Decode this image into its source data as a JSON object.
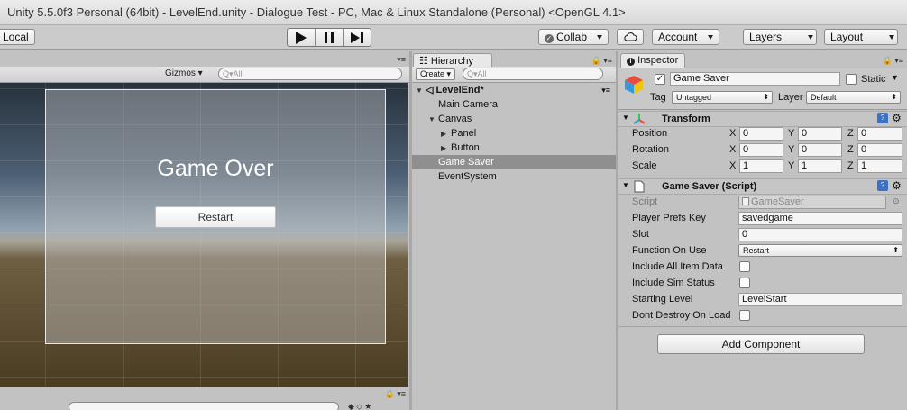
{
  "window": {
    "title": "Unity 5.5.0f3 Personal (64bit) - LevelEnd.unity - Dialogue Test - PC, Mac & Linux Standalone (Personal) <OpenGL 4.1>"
  },
  "toolbar": {
    "local_label": "Local",
    "collab_label": "Collab",
    "account_label": "Account",
    "layers_label": "Layers",
    "layout_label": "Layout"
  },
  "scene": {
    "gizmos_label": "Gizmos",
    "search_placeholder": "Q▾All",
    "game_over_text": "Game Over",
    "restart_label": "Restart"
  },
  "hierarchy": {
    "tab_label": "Hierarchy",
    "create_label": "Create",
    "search_placeholder": "Q▾All",
    "items": [
      {
        "label": "LevelEnd*",
        "indent": 0,
        "arrow": "down",
        "selected": false
      },
      {
        "label": "Main Camera",
        "indent": 1,
        "arrow": "",
        "selected": false
      },
      {
        "label": "Canvas",
        "indent": 1,
        "arrow": "down",
        "selected": false
      },
      {
        "label": "Panel",
        "indent": 2,
        "arrow": "right",
        "selected": false
      },
      {
        "label": "Button",
        "indent": 2,
        "arrow": "right",
        "selected": false
      },
      {
        "label": "Game Saver",
        "indent": 1,
        "arrow": "",
        "selected": true
      },
      {
        "label": "EventSystem",
        "indent": 1,
        "arrow": "",
        "selected": false
      }
    ]
  },
  "inspector": {
    "tab_label": "Inspector",
    "object_name": "Game Saver",
    "static_label": "Static",
    "tag_label": "Tag",
    "tag_value": "Untagged",
    "layer_label": "Layer",
    "layer_value": "Default",
    "transform": {
      "title": "Transform",
      "position_label": "Position",
      "rotation_label": "Rotation",
      "scale_label": "Scale",
      "position": [
        "0",
        "0",
        "0"
      ],
      "rotation": [
        "0",
        "0",
        "0"
      ],
      "scale": [
        "1",
        "1",
        "1"
      ],
      "axis_labels": [
        "X",
        "Y",
        "Z"
      ]
    },
    "script_component": {
      "title": "Game Saver (Script)",
      "script_label": "Script",
      "script_value": "GameSaver",
      "player_prefs_key_label": "Player Prefs Key",
      "player_prefs_key_value": "savedgame",
      "slot_label": "Slot",
      "slot_value": "0",
      "function_on_use_label": "Function On Use",
      "function_on_use_value": "Restart",
      "include_all_item_data_label": "Include All Item Data",
      "include_sim_status_label": "Include Sim Status",
      "starting_level_label": "Starting Level",
      "starting_level_value": "LevelStart",
      "dont_destroy_label": "Dont Destroy On Load"
    },
    "add_component_label": "Add Component"
  },
  "colors": {
    "selection": "#8f8f8f",
    "panel_bg": "#c2c2c2",
    "toolbar_bg": "#cbcbcb"
  }
}
